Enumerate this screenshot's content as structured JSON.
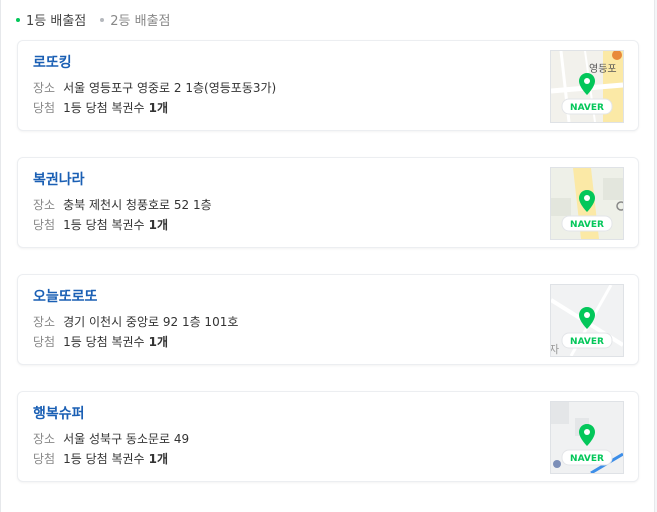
{
  "legend": {
    "first": "1등 배출점",
    "second": "2등 배출점"
  },
  "colors": {
    "accent": "#03c75a",
    "link": "#1a5fb4"
  },
  "stores": [
    {
      "name": "로또킹",
      "address_label": "장소",
      "address": "서울 영등포구 영중로 2 1층(영등포동3가)",
      "win_label": "당첨",
      "win_text": "1등 당첨 복권수",
      "win_count": "1개",
      "map_brand": "NAVER",
      "map_text": "영등포"
    },
    {
      "name": "복권나라",
      "address_label": "장소",
      "address": "충북 제천시 청풍호로 52 1층",
      "win_label": "당첨",
      "win_text": "1등 당첨 복권수",
      "win_count": "1개",
      "map_brand": "NAVER",
      "map_text": ""
    },
    {
      "name": "오늘또로또",
      "address_label": "장소",
      "address": "경기 이천시 중앙로 92 1층 101호",
      "win_label": "당첨",
      "win_text": "1등 당첨 복권수",
      "win_count": "1개",
      "map_brand": "NAVER",
      "map_text": "자"
    },
    {
      "name": "행복슈퍼",
      "address_label": "장소",
      "address": "서울 성북구 동소문로 49",
      "win_label": "당첨",
      "win_text": "1등 당첨 복권수",
      "win_count": "1개",
      "map_brand": "NAVER",
      "map_text": ""
    }
  ]
}
